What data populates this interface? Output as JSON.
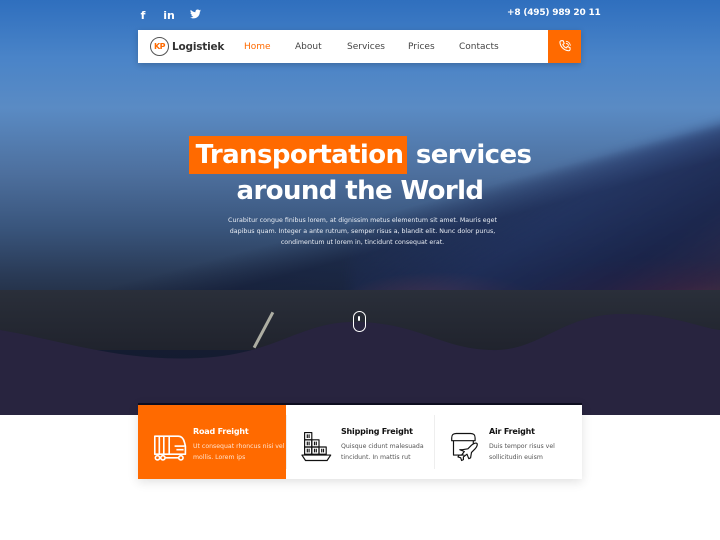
{
  "topbar": {
    "social": [
      {
        "name": "facebook-icon",
        "glyph": "f"
      },
      {
        "name": "linkedin-icon",
        "glyph": "in"
      },
      {
        "name": "twitter-icon",
        "glyph": "🐦"
      }
    ],
    "phone": "+8 (495) 989 20 11"
  },
  "navbar": {
    "logo_badge": "KP",
    "logo_text": "Logistiek",
    "items": [
      {
        "label": "Home",
        "active": true
      },
      {
        "label": "About",
        "active": false
      },
      {
        "label": "Services",
        "active": false
      },
      {
        "label": "Prices",
        "active": false
      },
      {
        "label": "Contacts",
        "active": false
      }
    ],
    "call_icon": "phone-icon"
  },
  "hero": {
    "headline_highlight": "Transportation",
    "headline_rest": "services",
    "headline_line2": "around the World",
    "description": "Curabitur congue finibus lorem, at dignissim metus elementum sit amet. Mauris eget dapibus quam. Integer a ante rutrum, semper risus a, blandit elit. Nunc dolor purus, condimentum ut lorem in, tincidunt consequat erat.",
    "scroll_icon": "mouse-scroll-icon"
  },
  "services": [
    {
      "title": "Road Freight",
      "text": "Ut consequat rhoncus nisi vel mollis. Lorem ips",
      "icon": "truck-icon",
      "featured": true
    },
    {
      "title": "Shipping Freight",
      "text": "Quisque cidunt malesuada tincidunt. In mattis rut",
      "icon": "cargo-ship-icon",
      "featured": false
    },
    {
      "title": "Air Freight",
      "text": "Duis tempor risus vel sollicitudin euism",
      "icon": "air-cargo-icon",
      "featured": false
    }
  ],
  "colors": {
    "accent": "#ff6a00",
    "dark_band": "#28243f",
    "white": "#ffffff"
  }
}
